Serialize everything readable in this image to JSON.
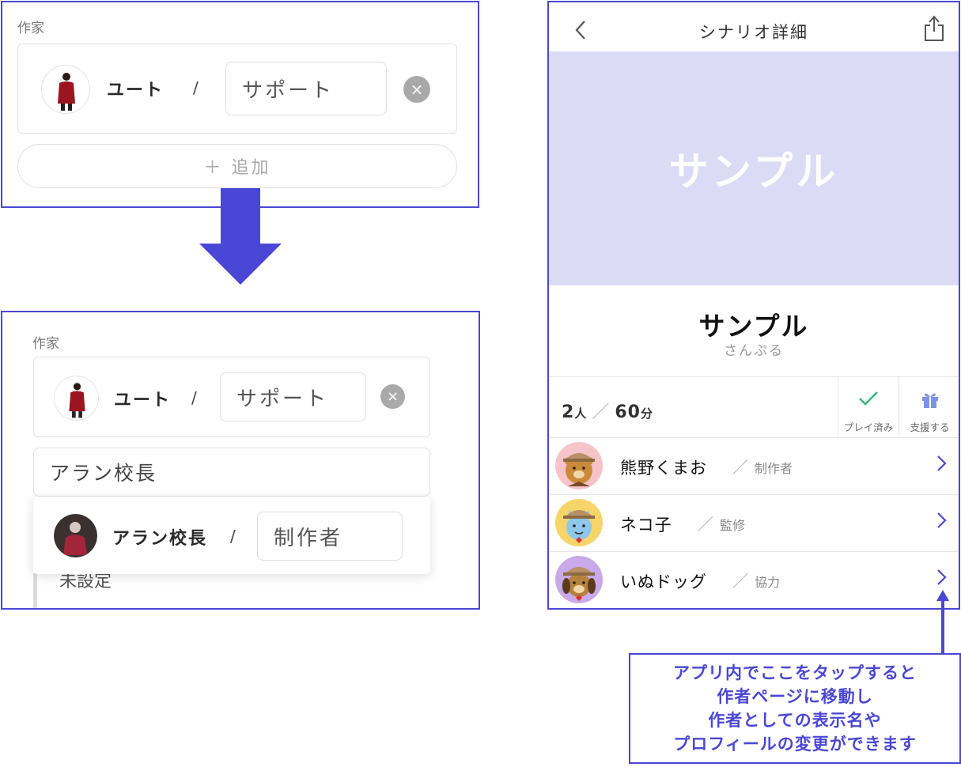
{
  "top_panel": {
    "label": "作家",
    "author_name": "ユート",
    "slash": "/",
    "role": "サポート",
    "remove_icon": "×",
    "add_label": "＋ 追加"
  },
  "bottom_panel": {
    "label": "作家",
    "author_name": "ユート",
    "slash": "/",
    "role": "サポート",
    "remove_icon": "×",
    "search_value": "アラン校長",
    "suggestion": {
      "name": "アラン校長",
      "slash": "/",
      "role": "制作者"
    },
    "underlying_text": "未設定"
  },
  "phone": {
    "nav_title": "シナリオ詳細",
    "hero_text": "サンプル",
    "title": "サンプル",
    "subtitle": "さんぷる",
    "stats": {
      "players": "2",
      "players_unit": "人",
      "sep": "／",
      "minutes": "60",
      "minutes_unit": "分"
    },
    "played_label": "プレイ済み",
    "support_label": "支援する",
    "authors": [
      {
        "name": "熊野くまお",
        "slash": "／",
        "role": "制作者",
        "avatar": "bear-avatar",
        "avatar_bg": "#f6c3c8"
      },
      {
        "name": "ネコ子",
        "slash": "／",
        "role": "監修",
        "avatar": "cat-avatar",
        "avatar_bg": "#f7d46a"
      },
      {
        "name": "いぬドッグ",
        "slash": "／",
        "role": "協力",
        "avatar": "dog-avatar",
        "avatar_bg": "#c9a9e8"
      }
    ]
  },
  "annotation": {
    "lines": [
      "アプリ内でここをタップすると",
      "作者ページに移動し",
      "作者としての表示名や",
      "プロフィールの変更ができます"
    ]
  },
  "colors": {
    "accent": "#4a47d6",
    "hero_bg": "#dcdbf6",
    "check": "#3cb878",
    "gift": "#7c93e8"
  }
}
